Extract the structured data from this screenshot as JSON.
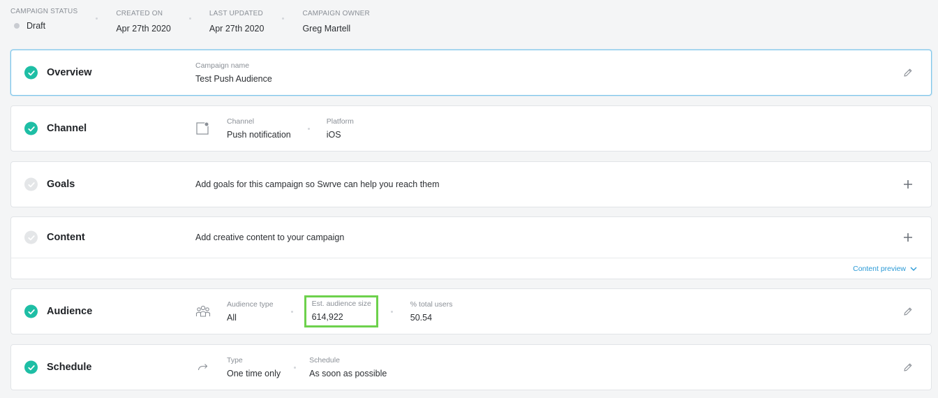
{
  "meta": {
    "status": {
      "label": "CAMPAIGN STATUS",
      "value": "Draft"
    },
    "created": {
      "label": "CREATED ON",
      "value": "Apr 27th 2020"
    },
    "updated": {
      "label": "LAST UPDATED",
      "value": "Apr 27th 2020"
    },
    "owner": {
      "label": "CAMPAIGN OWNER",
      "value": "Greg Martell"
    }
  },
  "overview": {
    "title": "Overview",
    "name_label": "Campaign name",
    "name_value": "Test Push Audience",
    "action_icon": "pencil-icon"
  },
  "channel": {
    "title": "Channel",
    "icon": "push-notification-icon",
    "channel_label": "Channel",
    "channel_value": "Push notification",
    "platform_label": "Platform",
    "platform_value": "iOS"
  },
  "goals": {
    "title": "Goals",
    "text": "Add goals for this campaign so Swrve can help you reach them",
    "action_icon": "plus-icon"
  },
  "content": {
    "title": "Content",
    "text": "Add creative content to your campaign",
    "action_icon": "plus-icon",
    "preview_link": "Content preview"
  },
  "audience": {
    "title": "Audience",
    "icon": "users-group-icon",
    "type_label": "Audience type",
    "type_value": "All",
    "size_label": "Est. audience size",
    "size_value": "614,922",
    "pct_label": "% total users",
    "pct_value": "50.54",
    "action_icon": "pencil-icon"
  },
  "schedule": {
    "title": "Schedule",
    "icon": "arrow-forward-icon",
    "type_label": "Type",
    "type_value": "One time only",
    "schedule_label": "Schedule",
    "schedule_value": "As soon as possible",
    "action_icon": "pencil-icon"
  },
  "colors": {
    "complete": "#1ebea5",
    "pending": "#e4e6e8",
    "link": "#2b9ad6",
    "highlight": "#6dd14c",
    "active_border": "#7fc6ea"
  }
}
